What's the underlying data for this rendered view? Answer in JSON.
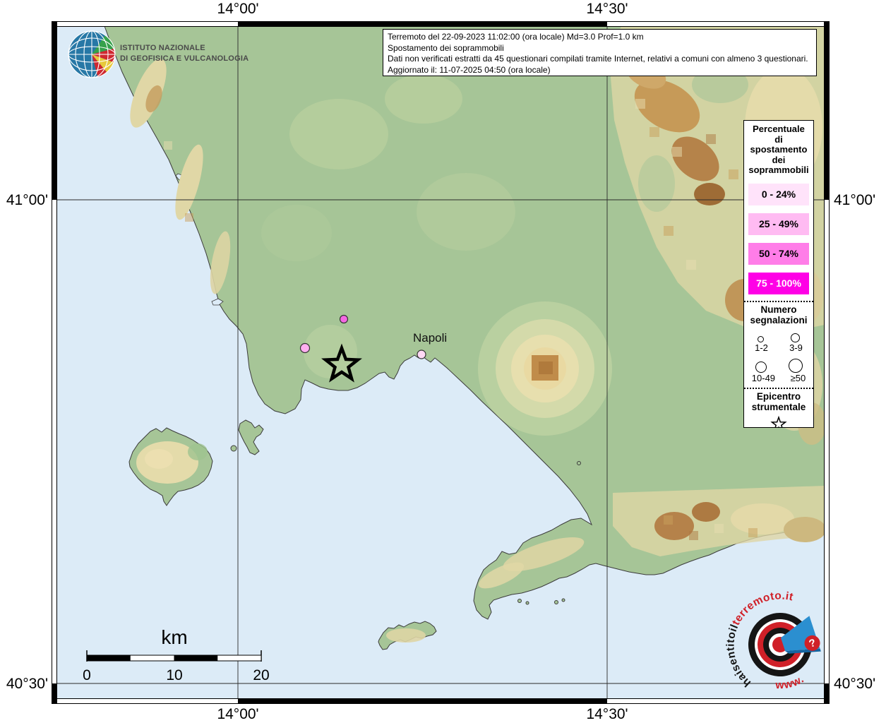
{
  "branding": {
    "institute_line1": "ISTITUTO NAZIONALE",
    "institute_line2": "DI GEOFISICA E VULCANOLOGIA"
  },
  "info_box": {
    "line1": "Terremoto del 22-09-2023 11:02:00 (ora locale) Md=3.0 Prof=1.0 km",
    "line2": "Spostamento dei soprammobili",
    "line3": "Dati non verificati estratti da 45 questionari compilati tramite Internet, relativi a comuni con almeno 3 questionari.",
    "line4": "Aggiornato il: 11-07-2025 04:50 (ora locale)"
  },
  "map": {
    "coords": {
      "top_left": "14°00'",
      "top_right": "14°30'",
      "bottom_left": "14°00'",
      "bottom_right": "14°30'",
      "left_top": "41°00'",
      "left_bottom": "40°30'",
      "right_top": "41°00'",
      "right_bottom": "40°30'"
    },
    "city_label": "Napoli",
    "colors": {
      "sea": "#dcebf7",
      "land": "#a6c597",
      "coastline": "#3b3b3b"
    },
    "markers": [
      {
        "class": "50 - 74%",
        "color": "#f468e2"
      },
      {
        "class": "25 - 49%",
        "color": "#ffaff0"
      },
      {
        "class": "0 - 24%",
        "color": "#ffd9f6"
      }
    ],
    "epicenter_symbol": "star"
  },
  "legend": {
    "title_lines": [
      "Percentuale",
      "di",
      "spostamento",
      "dei",
      "soprammobili"
    ],
    "classes": [
      {
        "label": "0 - 24%",
        "color": "#ffe3fa",
        "text": "#000000"
      },
      {
        "label": "25 - 49%",
        "color": "#ffbbf2",
        "text": "#000000"
      },
      {
        "label": "50 - 74%",
        "color": "#ff7de8",
        "text": "#000000"
      },
      {
        "label": "75 - 100%",
        "color": "#ff00e6",
        "text": "#ffffff"
      }
    ],
    "signals": {
      "title_line1": "Numero",
      "title_line2": "segnalazioni",
      "items": [
        {
          "label": "1-2"
        },
        {
          "label": "3-9"
        },
        {
          "label": "10-49"
        },
        {
          "label": "≥50"
        }
      ]
    },
    "epicenter": {
      "title_line1": "Epicentro",
      "title_line2": "strumentale"
    }
  },
  "scale_bar": {
    "unit": "km",
    "tick0": "0",
    "tick1": "10",
    "tick2": "20"
  },
  "watermark": {
    "text_black": "haisentitoil",
    "text_red": "terremoto.it",
    "text_bottom": "www.",
    "question_mark": "?"
  }
}
